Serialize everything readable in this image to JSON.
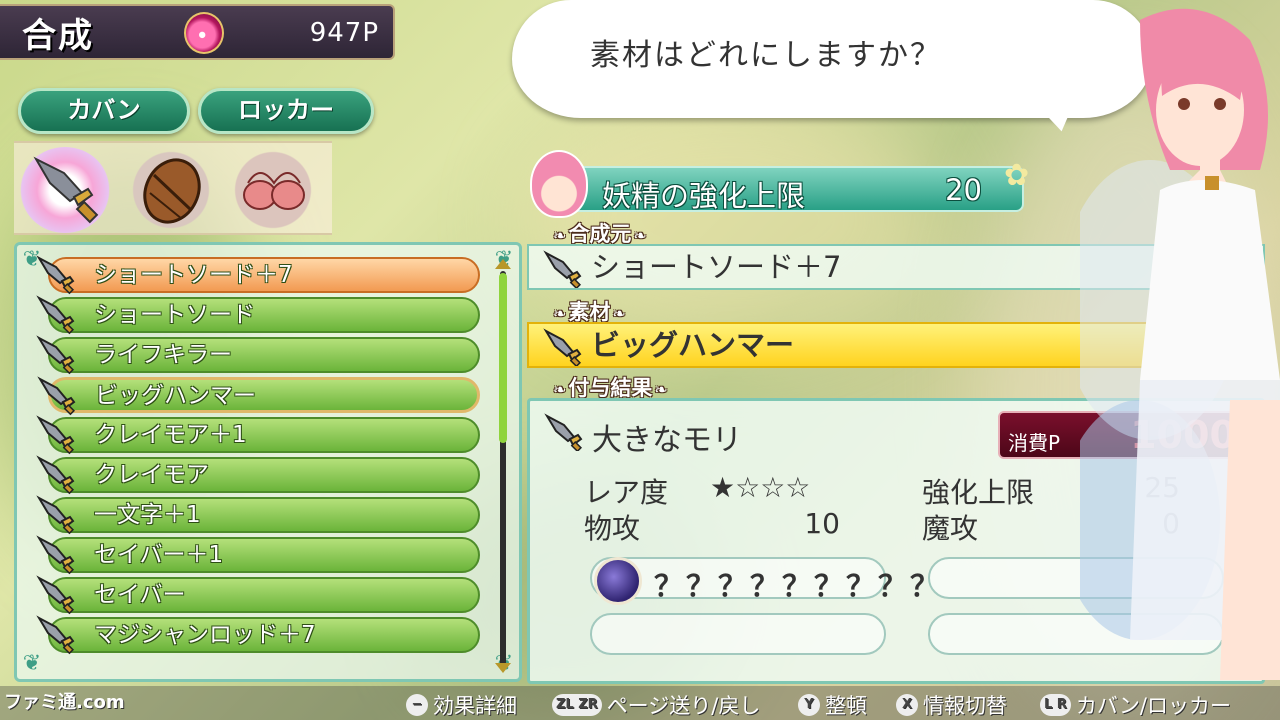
{
  "header": {
    "title": "合成",
    "points": "947P"
  },
  "tabs": [
    {
      "label": "カバン"
    },
    {
      "label": "ロッカー"
    }
  ],
  "categories": [
    "weapon-icon",
    "shield-icon",
    "armor-icon"
  ],
  "item_list": [
    {
      "name": "ショートソード＋7",
      "state": "selected"
    },
    {
      "name": "ショートソード",
      "state": ""
    },
    {
      "name": "ライフキラー",
      "state": ""
    },
    {
      "name": "ビッグハンマー",
      "state": "material"
    },
    {
      "name": "クレイモア＋1",
      "state": ""
    },
    {
      "name": "クレイモア",
      "state": ""
    },
    {
      "name": "一文字＋1",
      "state": ""
    },
    {
      "name": "セイバー＋1",
      "state": ""
    },
    {
      "name": "セイバー",
      "state": ""
    },
    {
      "name": "マジシャンロッド＋7",
      "state": ""
    }
  ],
  "dialog": {
    "text": "素材はどれにしますか？"
  },
  "fairy_limit": {
    "label": "妖精の強化上限",
    "value": "20"
  },
  "sections": {
    "source": "合成元",
    "material": "素材",
    "result": "付与結果"
  },
  "source_item": "ショートソード＋7",
  "material_item": "ビッグハンマー",
  "result": {
    "name": "大きなモリ",
    "cost_label": "消費P",
    "cost_value": "1000",
    "rarity_label": "レア度",
    "rarity_value": "★☆☆☆",
    "limit_label": "強化上限",
    "limit_value": "25",
    "phys_label": "物攻",
    "phys_value": "10",
    "magic_label": "魔攻",
    "magic_value": "0",
    "skill1": "？？？？？？？？？"
  },
  "footer": {
    "watermark": "ファミ通.com",
    "hints": [
      {
        "button": "−",
        "label": "効果詳細"
      },
      {
        "button": "ZL ZR",
        "label": "ページ送り/戻し"
      },
      {
        "button": "Y",
        "label": "整頓"
      },
      {
        "button": "X",
        "label": "情報切替"
      },
      {
        "button": "L R",
        "label": "カバン/ロッカー"
      }
    ]
  },
  "colors": {
    "accent_green": "#29a086",
    "material_yellow": "#ffd31f",
    "cost_red": "#ff5a5a",
    "list_green": "#6bb43a",
    "list_selected_orange": "#f29a52"
  }
}
